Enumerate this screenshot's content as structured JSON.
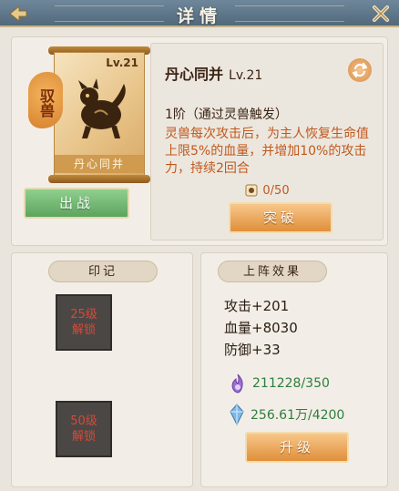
{
  "header": {
    "title": "详情"
  },
  "beast_card": {
    "type_tag": "驭兽",
    "level": "Lv.21",
    "name": "丹心同并",
    "deploy_label": "出战"
  },
  "skill": {
    "name": "丹心同并",
    "level": "Lv.21",
    "rank": "1阶（通过灵兽触发）",
    "description": "灵兽每次攻击后，为主人恢复生命值上限5%的血量，并增加10%的攻击力，持续2回合",
    "exp": "0/50",
    "breakthrough_label": "突破"
  },
  "seal": {
    "title": "印记",
    "slots": [
      {
        "line1": "25级",
        "line2": "解锁"
      },
      {
        "line1": "50级",
        "line2": "解锁"
      }
    ]
  },
  "battle_effect": {
    "title": "上阵效果",
    "stats": [
      "攻击+201",
      "血量+8030",
      "防御+33"
    ],
    "resource_purple": "211228/350",
    "resource_blue": "256.61万/4200",
    "upgrade_label": "升级"
  },
  "colors": {
    "header": "#5f788b",
    "accent_orange": "#e08f3a",
    "deploy_green": "#5da45e",
    "desc_text": "#c0581e",
    "resource_text": "#2e7d3e"
  },
  "icons": {
    "back": "back-arrow-icon",
    "close": "close-x-icon",
    "refresh": "refresh-icon",
    "exp": "scroll-token-icon",
    "purple_resource": "purple-flame-icon",
    "blue_resource": "blue-crystal-icon",
    "beast": "beast-illustration"
  }
}
